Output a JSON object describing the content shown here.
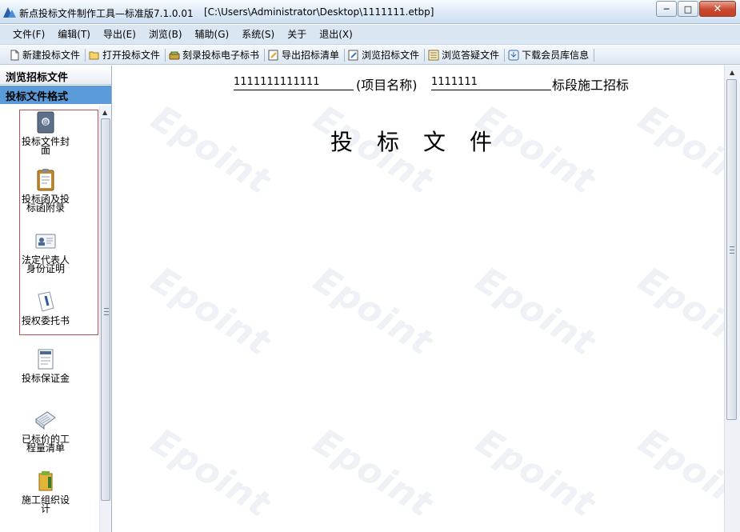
{
  "window": {
    "title": "新点投标文件制作工具—标准版7.1.0.01",
    "path": "[C:\\Users\\Administrator\\Desktop\\1111111.etbp]",
    "minimize": "─",
    "maximize": "□",
    "close": "✕"
  },
  "menu": [
    {
      "label": "文件(F)"
    },
    {
      "label": "编辑(T)"
    },
    {
      "label": "导出(E)"
    },
    {
      "label": "浏览(B)"
    },
    {
      "label": "辅助(G)"
    },
    {
      "label": "系统(S)"
    },
    {
      "label": "关于"
    },
    {
      "label": "退出(X)"
    }
  ],
  "toolbar": [
    {
      "label": "新建投标文件",
      "icon": "new-file-icon"
    },
    {
      "label": "打开投标文件",
      "icon": "open-folder-icon"
    },
    {
      "label": "刻录投标电子标书",
      "icon": "burn-disc-icon"
    },
    {
      "label": "导出招标清单",
      "icon": "export-list-icon"
    },
    {
      "label": "浏览招标文件",
      "icon": "browse-file-icon"
    },
    {
      "label": "浏览答疑文件",
      "icon": "browse-faq-icon"
    },
    {
      "label": "下载会员库信息",
      "icon": "download-info-icon"
    }
  ],
  "sidebar": {
    "tab_browse": "浏览招标文件",
    "tab_format": "投标文件格式",
    "items": [
      {
        "line1": "投标文件封",
        "line2": "面",
        "icon": "address-book-icon"
      },
      {
        "line1": "投标函及投",
        "line2": "标函附录",
        "icon": "clipboard-icon"
      },
      {
        "line1": "法定代表人",
        "line2": "身份证明",
        "icon": "id-card-icon"
      },
      {
        "line1": "授权委托书",
        "line2": "",
        "icon": "pen-document-icon"
      },
      {
        "line1": "投标保证金",
        "line2": "",
        "icon": "deposit-document-icon"
      },
      {
        "line1": "已标价的工",
        "line2": "程量清单",
        "icon": "priced-list-icon"
      },
      {
        "line1": "施工组织设",
        "line2": "计",
        "icon": "folder-design-icon"
      }
    ]
  },
  "document": {
    "project_code": "1111111111111",
    "project_name_label": "(项目名称)",
    "project_name": "1111111",
    "section_suffix": "标段施工招标",
    "heading": "投标文件",
    "watermark": "Epoint"
  },
  "colors": {
    "selected_tab": "#5b9bd9",
    "selection_border": "#c0504d",
    "close_button": "#c9472e"
  }
}
